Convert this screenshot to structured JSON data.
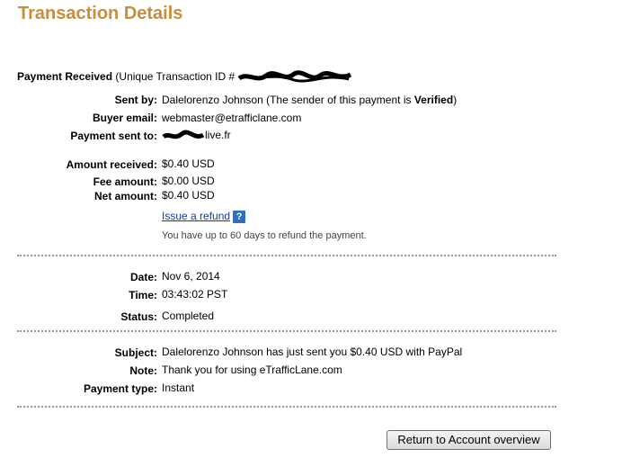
{
  "title": "Transaction Details",
  "header": {
    "payment_received": "Payment Received",
    "transaction_prefix": "(Unique Transaction ID #"
  },
  "fields": {
    "sent_by_label": "Sent by:",
    "sent_by_value": "Dalelorenzo Johnson (The sender of this payment is ",
    "sent_by_verified": "Verified",
    "sent_by_suffix": ")",
    "buyer_email_label": "Buyer email:",
    "buyer_email_value": "webmaster@etrafficlane.com",
    "payment_sent_to_label": "Payment sent to:",
    "payment_sent_to_value": "live.fr",
    "amount_received_label": "Amount received:",
    "amount_received_value": "$0.40 USD",
    "fee_amount_label": "Fee amount:",
    "fee_amount_value": "$0.00 USD",
    "net_amount_label": "Net amount:",
    "net_amount_value": "$0.40 USD",
    "issue_refund": "Issue a refund",
    "help_glyph": "?",
    "refund_note": "You have up to 60 days to refund the payment.",
    "date_label": "Date:",
    "date_value": "Nov 6, 2014",
    "time_label": "Time:",
    "time_value": "03:43:02 PST",
    "status_label": "Status:",
    "status_value": "Completed",
    "subject_label": "Subject:",
    "subject_value": "Dalelorenzo Johnson has just sent you $0.40 USD with PayPal",
    "note_label": "Note:",
    "note_value": "Thank you for using eTrafficLane.com",
    "payment_type_label": "Payment type:",
    "payment_type_value": "Instant"
  },
  "buttons": {
    "return": "Return to Account overview"
  },
  "colors": {
    "title": "#c68e3f",
    "link": "#1a3c8f",
    "help_icon": "#2f6fbf"
  }
}
